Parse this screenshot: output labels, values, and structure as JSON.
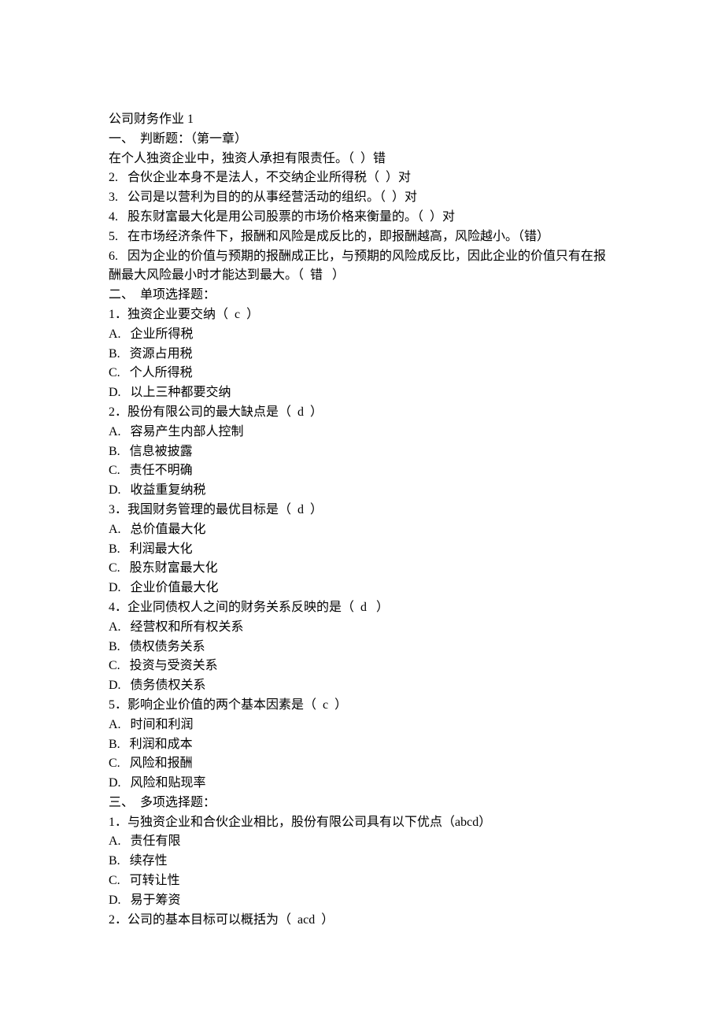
{
  "lines": [
    "公司财务作业 1",
    "一、  判断题：（第一章）",
    "在个人独资企业中，独资人承担有限责任。（  ）错",
    "2.   合伙企业本身不是法人，不交纳企业所得税（  ）对",
    "3.   公司是以营利为目的的从事经营活动的组织。（  ）对",
    "4.   股东财富最大化是用公司股票的市场价格来衡量的。（  ）对",
    "5.   在市场经济条件下，报酬和风险是成反比的，即报酬越高，风险越小。（错）",
    "6.   因为企业的价值与预期的报酬成正比，与预期的风险成反比，因此企业的价值只有在报酬最大风险最小时才能达到最大。（  错   ）",
    "二、  单项选择题：",
    "1．独资企业要交纳（  c  ）",
    "A.   企业所得税",
    "B.   资源占用税",
    "C.   个人所得税",
    "D.   以上三种都要交纳",
    "2．股份有限公司的最大缺点是（  d  ）",
    "A.   容易产生内部人控制",
    "B.   信息被披露",
    "C.   责任不明确",
    "D.   收益重复纳税",
    "3．我国财务管理的最优目标是（  d  ）",
    "A.   总价值最大化",
    "B.   利润最大化",
    "C.   股东财富最大化",
    "D.   企业价值最大化",
    "4．企业同债权人之间的财务关系反映的是（  d   ）",
    "A.   经营权和所有权关系",
    "B.   债权债务关系",
    "C.   投资与受资关系",
    "D.   债务债权关系",
    "5．影响企业价值的两个基本因素是（  c  ）",
    "A.   时间和利润",
    "B.   利润和成本",
    "C.   风险和报酬",
    "D.   风险和贴现率",
    "三、  多项选择题：",
    "1．与独资企业和合伙企业相比，股份有限公司具有以下优点（abcd）",
    "A.   责任有限",
    "B.   续存性",
    "C.   可转让性",
    "D.   易于筹资",
    "2．公司的基本目标可以概括为（  acd  ）"
  ]
}
